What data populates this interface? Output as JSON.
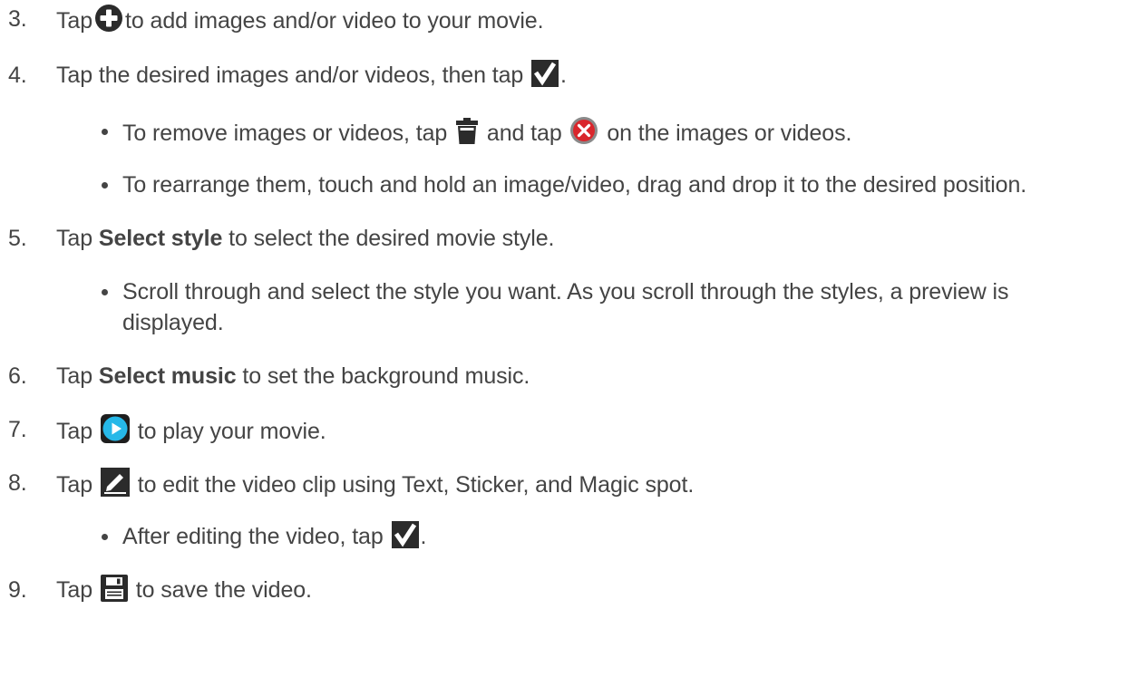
{
  "steps": {
    "s3": {
      "number": "3.",
      "before": "Tap",
      "icon": "add-circle-icon",
      "after": "to add images and/or video to your movie."
    },
    "s4": {
      "number": "4.",
      "before": "Tap the desired images and/or videos, then tap",
      "icon": "checkmark-icon",
      "after": ".",
      "bullets": [
        {
          "before": "To remove images or videos, tap",
          "icon1": "trash-icon",
          "middle": "and tap",
          "icon2": "remove-red-x-icon",
          "after": "on the images or videos."
        },
        {
          "text": "To rearrange them, touch and hold an image/video, drag and drop it to the desired position."
        }
      ]
    },
    "s5": {
      "number": "5.",
      "before": "Tap",
      "bold": "Select style",
      "after": "to select the desired movie style.",
      "bullets": [
        {
          "text": "Scroll through and select the style you want. As you scroll through the styles, a preview is displayed."
        }
      ]
    },
    "s6": {
      "number": "6.",
      "before": "Tap",
      "bold": "Select music",
      "after": "to set the background music."
    },
    "s7": {
      "number": "7.",
      "before": "Tap",
      "icon": "play-icon",
      "after": "to play your movie."
    },
    "s8": {
      "number": "8.",
      "before": "Tap",
      "icon": "edit-pencil-icon",
      "after": "to edit the video clip using Text, Sticker, and Magic spot.",
      "bullets": [
        {
          "before": "After editing the video, tap",
          "icon": "checkmark-icon",
          "after": "."
        }
      ]
    },
    "s9": {
      "number": "9.",
      "before": "Tap",
      "icon": "save-disk-icon",
      "after": "to save the video."
    }
  },
  "colors": {
    "text": "#444444",
    "icon_dark": "#2b2b2b",
    "remove_red": "#d9262c",
    "play_blue": "#26b8e8"
  }
}
